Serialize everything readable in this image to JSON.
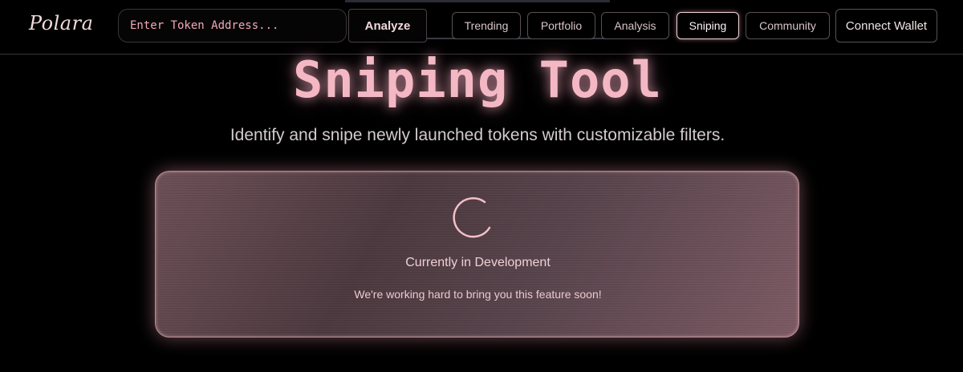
{
  "header": {
    "logo": "Polara",
    "search": {
      "placeholder": "Enter Token Address...",
      "value": ""
    },
    "analyze_label": "Analyze",
    "nav": [
      {
        "label": "Trending"
      },
      {
        "label": "Portfolio"
      },
      {
        "label": "Analysis"
      },
      {
        "label": "Sniping",
        "active": true
      },
      {
        "label": "Community"
      }
    ],
    "connect_label": "Connect Wallet"
  },
  "main": {
    "title": "Sniping Tool",
    "subtitle": "Identify and snipe newly launched tokens with customizable filters.",
    "card": {
      "status_icon": "loading-spinner-icon",
      "status": "Currently in Development",
      "message": "We're working hard to bring you this feature soon!"
    }
  },
  "colors": {
    "background": "#000000",
    "accent_pink": "#f4b8c4",
    "card_border": "#b88c95",
    "card_fill": "#5a434a"
  }
}
